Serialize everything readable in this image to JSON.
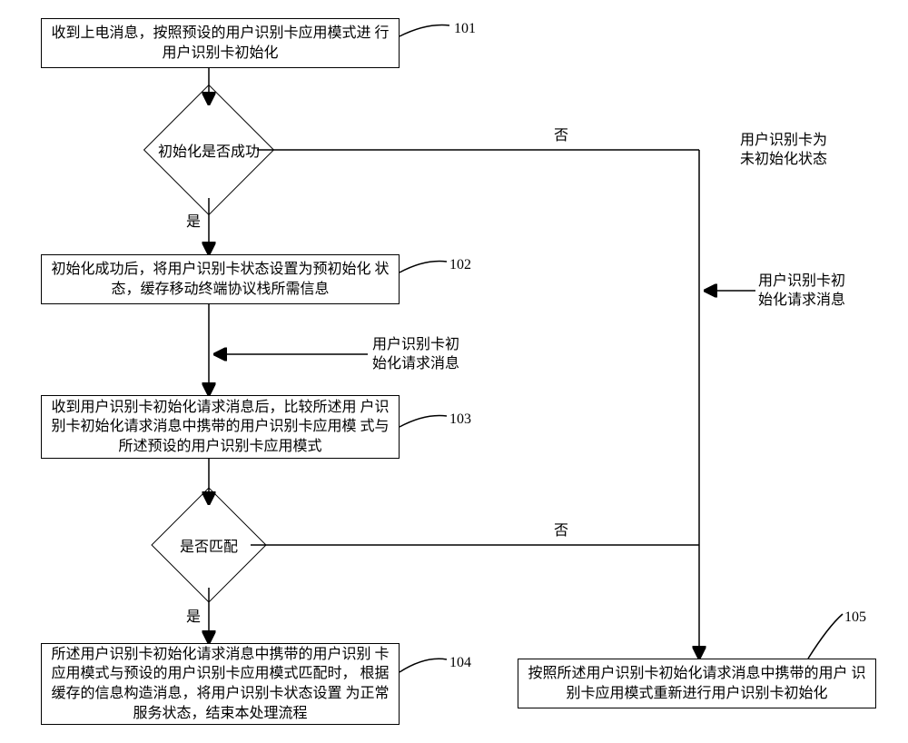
{
  "chart_data": {
    "type": "flowchart",
    "nodes": [
      {
        "id": "101",
        "type": "process",
        "text": "收到上电消息，按照预设的用户识别卡应用模式进行用户识别卡初始化",
        "ref": "101"
      },
      {
        "id": "d1",
        "type": "decision",
        "text": "初始化是否成功"
      },
      {
        "id": "102",
        "type": "process",
        "text": "初始化成功后，将用户识别卡状态设置为预初始化状态，缓存移动终端协议栈所需信息",
        "ref": "102"
      },
      {
        "id": "103",
        "type": "process",
        "text": "收到用户识别卡初始化请求消息后，比较所述用户识别卡初始化请求消息中携带的用户识别卡应用模式与所述预设的用户识别卡应用模式",
        "ref": "103"
      },
      {
        "id": "d2",
        "type": "decision",
        "text": "是否匹配"
      },
      {
        "id": "104",
        "type": "process",
        "text": "所述用户识别卡初始化请求消息中携带的用户识别卡应用模式与预设的用户识别卡应用模式匹配时，根据缓存的信息构造消息，将用户识别卡状态设置为正常服务状态，结束本处理流程",
        "ref": "104"
      },
      {
        "id": "105",
        "type": "process",
        "text": "按照所述用户识别卡初始化请求消息中携带的用户识别卡应用模式重新进行用户识别卡初始化",
        "ref": "105"
      }
    ],
    "edges": [
      {
        "from": "101",
        "to": "d1"
      },
      {
        "from": "d1",
        "to": "102",
        "label": "是"
      },
      {
        "from": "d1",
        "to": "right-branch",
        "label": "否",
        "side_label": "用户识别卡为未初始化状态"
      },
      {
        "from": "102",
        "to": "103",
        "label": "用户识别卡初始化请求消息"
      },
      {
        "from": "103",
        "to": "d2"
      },
      {
        "from": "d2",
        "to": "104",
        "label": "是"
      },
      {
        "from": "d2",
        "to": "right-branch",
        "label": "否"
      },
      {
        "from": "right-external",
        "to": "right-branch",
        "label": "用户识别卡初始化请求消息"
      },
      {
        "from": "right-branch",
        "to": "105"
      }
    ]
  },
  "boxes": {
    "b101": "收到上电消息，按照预设的用户识别卡应用模式进\n行用户识别卡初始化",
    "b102": "初始化成功后，将用户识别卡状态设置为预初始化\n状态，缓存移动终端协议栈所需信息",
    "b103": "收到用户识别卡初始化请求消息后，比较所述用\n户识别卡初始化请求消息中携带的用户识别卡应用模\n式与所述预设的用户识别卡应用模式",
    "b104": "所述用户识别卡初始化请求消息中携带的用户识别\n卡应用模式与预设的用户识别卡应用模式匹配时，\n根据缓存的信息构造消息，将用户识别卡状态设置\n为正常服务状态，结束本处理流程",
    "b105": "按照所述用户识别卡初始化请求消息中携带的用户\n识别卡应用模式重新进行用户识别卡初始化"
  },
  "diamonds": {
    "d1": "初始化是否成功",
    "d2": "是否匹配"
  },
  "labels": {
    "ref101": "101",
    "ref102": "102",
    "ref103": "103",
    "ref104": "104",
    "ref105": "105",
    "yes1": "是",
    "no1": "否",
    "yes2": "是",
    "no2": "否",
    "uninit_state": "用户识别卡为\n未初始化状态",
    "init_req_msg_left": "用户识别卡初\n始化请求消息",
    "init_req_msg_right": "用户识别卡初\n始化请求消息"
  }
}
